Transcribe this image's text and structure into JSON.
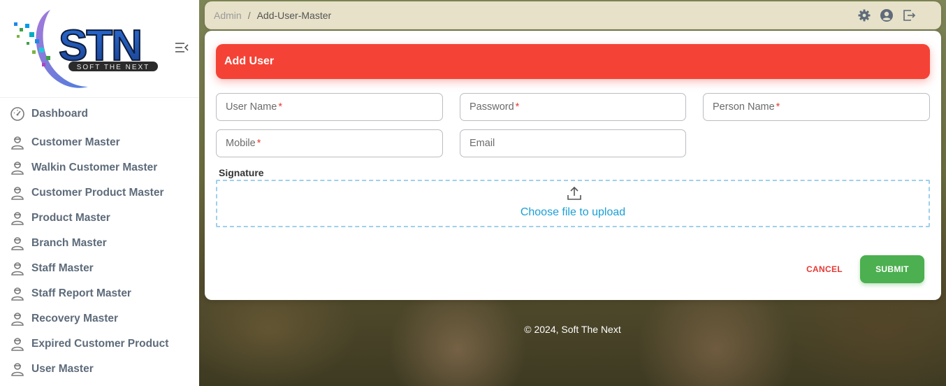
{
  "brand": {
    "logo_text": "STN",
    "logo_tagline": "SOFT THE NEXT"
  },
  "sidebar": {
    "items": [
      {
        "label": "Dashboard",
        "icon": "dashboard-gauge-icon"
      },
      {
        "label": "Customer Master",
        "icon": "user-icon"
      },
      {
        "label": "Walkin Customer Master",
        "icon": "user-icon"
      },
      {
        "label": "Customer Product Master",
        "icon": "user-icon"
      },
      {
        "label": "Product Master",
        "icon": "user-icon"
      },
      {
        "label": "Branch Master",
        "icon": "user-icon"
      },
      {
        "label": "Staff Master",
        "icon": "user-icon"
      },
      {
        "label": "Staff Report Master",
        "icon": "user-icon"
      },
      {
        "label": "Recovery Master",
        "icon": "user-icon"
      },
      {
        "label": "Expired Customer Product",
        "icon": "user-icon"
      },
      {
        "label": "User Master",
        "icon": "user-icon"
      }
    ]
  },
  "topbar": {
    "breadcrumb_root": "Admin",
    "breadcrumb_sep": "/",
    "breadcrumb_current": "Add-User-Master",
    "icons": [
      "gear-icon",
      "account-icon",
      "logout-icon"
    ]
  },
  "form": {
    "title": "Add User",
    "fields": {
      "user_name": {
        "label": "User Name",
        "required_mark": "*"
      },
      "password": {
        "label": "Password",
        "required_mark": "*"
      },
      "person_name": {
        "label": "Person Name",
        "required_mark": "*"
      },
      "mobile": {
        "label": "Mobile",
        "required_mark": "*"
      },
      "email": {
        "label": "Email"
      }
    },
    "signature_label": "Signature",
    "upload_text": "Choose file to upload",
    "cancel_label": "CANCEL",
    "submit_label": "SUBMIT"
  },
  "footer": {
    "text": "© 2024, Soft The Next"
  },
  "colors": {
    "header_red": "#f44336",
    "submit_green": "#4caf50",
    "cancel_red": "#e53935",
    "link_blue": "#1a9fd6"
  }
}
